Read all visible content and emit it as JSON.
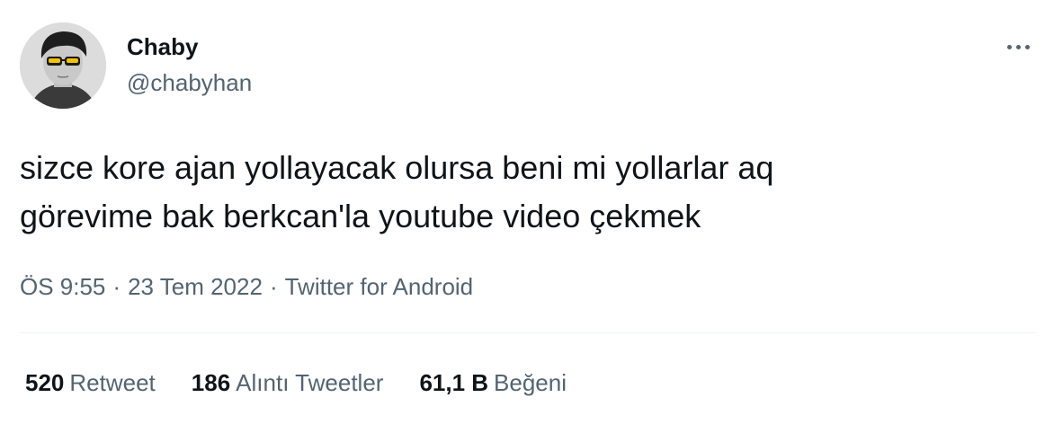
{
  "user": {
    "display_name": "Chaby",
    "handle": "@chabyhan"
  },
  "tweet": {
    "lines": [
      "sizce kore ajan yollayacak olursa beni mi yollarlar aq",
      "görevime bak berkcan'la youtube video çekmek"
    ]
  },
  "meta": {
    "time": "ÖS 9:55",
    "separator": "·",
    "date": "23 Tem 2022",
    "source": "Twitter for Android"
  },
  "stats": [
    {
      "count": "520",
      "label": "Retweet"
    },
    {
      "count": "186",
      "label": "Alıntı Tweetler"
    },
    {
      "count": "61,1 B",
      "label": "Beğeni"
    }
  ],
  "icons": {
    "more": "more-horizontal-icon"
  },
  "colors": {
    "text": "#0f1419",
    "secondary": "#536471",
    "divider": "#eff3f4",
    "glasses": "#f5c400"
  }
}
